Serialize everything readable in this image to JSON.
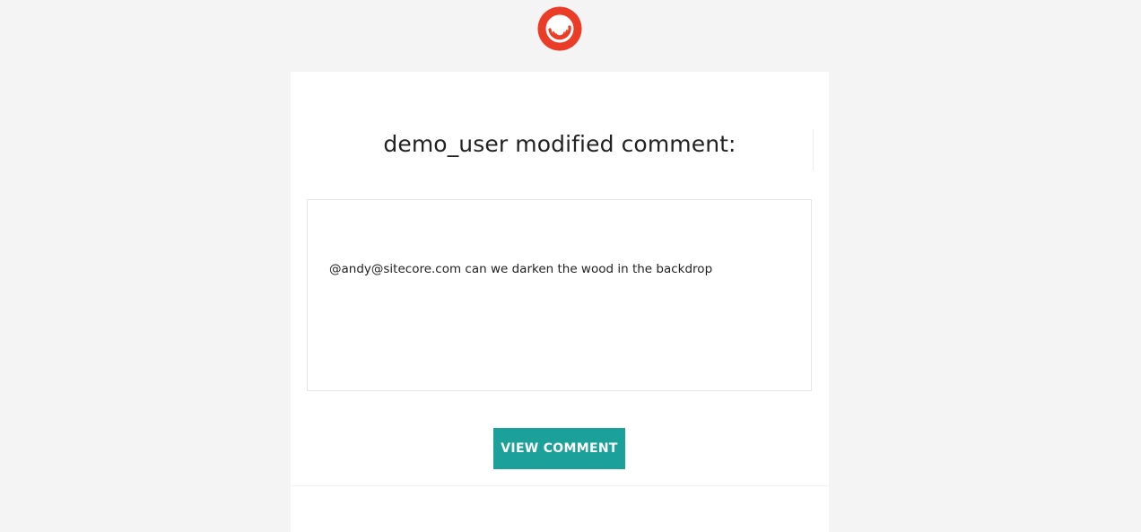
{
  "logo": {
    "icon": "sitecore-logo-icon",
    "color": "#eb3c27"
  },
  "notification": {
    "title": "demo_user modified comment:",
    "comment": "@andy@sitecore.com can we darken the wood in the  backdrop",
    "button_label": "VIEW COMMENT"
  },
  "colors": {
    "page_background": "#f4f4f4",
    "card_background": "#ffffff",
    "button": "#1ba19a"
  }
}
